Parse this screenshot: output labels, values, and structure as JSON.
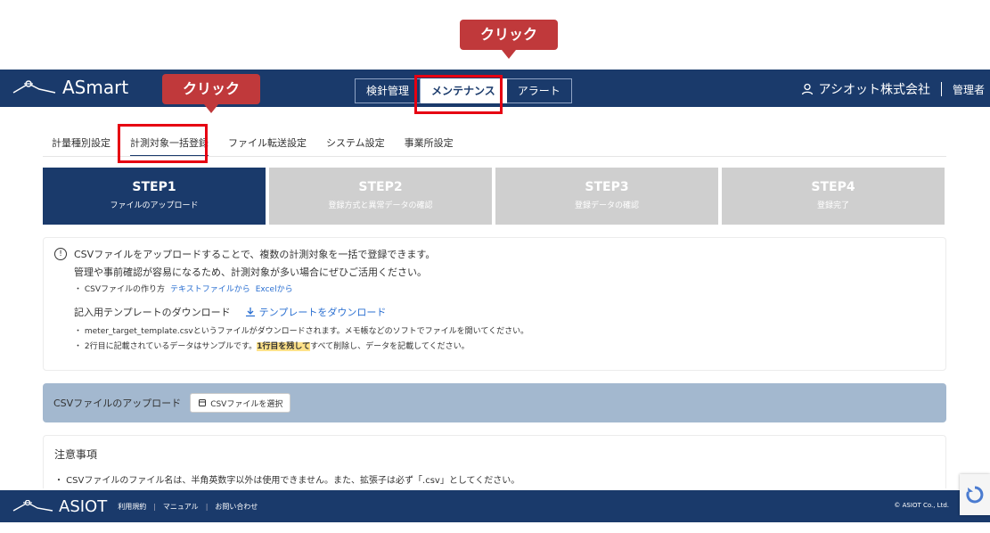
{
  "callouts": {
    "top": "クリック",
    "left": "クリック"
  },
  "header": {
    "logo_text": "ASmart",
    "tabs": [
      {
        "label": "検針管理"
      },
      {
        "label": "メンテナンス"
      },
      {
        "label": "アラート"
      }
    ],
    "company": "アシオット株式会社",
    "role": "管理者"
  },
  "subnav": [
    {
      "label": "計量種別設定"
    },
    {
      "label": "計測対象一括登録"
    },
    {
      "label": "ファイル転送設定"
    },
    {
      "label": "システム設定"
    },
    {
      "label": "事業所設定"
    }
  ],
  "steps": [
    {
      "title": "STEP1",
      "sub": "ファイルのアップロード"
    },
    {
      "title": "STEP2",
      "sub": "登録方式と異常データの確認"
    },
    {
      "title": "STEP3",
      "sub": "登録データの確認"
    },
    {
      "title": "STEP4",
      "sub": "登録完了"
    }
  ],
  "info": {
    "line1": "CSVファイルをアップロードすることで、複数の計測対象を一括で登録できます。",
    "line2": "管理や事前確認が容易になるため、計測対象が多い場合にぜひご活用ください。",
    "howto_label": "・ CSVファイルの作り方",
    "howto_link1": "テキストファイルから",
    "howto_link2": "Excelから",
    "template_label": "記入用テンプレートのダウンロード",
    "template_link": "テンプレートをダウンロード",
    "note1": "・ meter_target_template.csvというファイルがダウンロードされます。メモ帳などのソフトでファイルを開いてください。",
    "note2_pre": "・ 2行目に記載されているデータはサンプルです。",
    "note2_hl": "1行目を残して",
    "note2_post": "すべて削除し、データを記載してください。"
  },
  "upload": {
    "label": "CSVファイルのアップロード",
    "button": "CSVファイルを選択"
  },
  "notes": {
    "title": "注意事項",
    "text": "・ CSVファイルのファイル名は、半角英数字以外は使用できません。また、拡張子は必ず「.csv」としてください。"
  },
  "footer": {
    "logo_text": "ASIOT",
    "links": [
      "利用規約",
      "マニュアル",
      "お問い合わせ"
    ],
    "copyright": "© ASIOT Co., Ltd."
  }
}
